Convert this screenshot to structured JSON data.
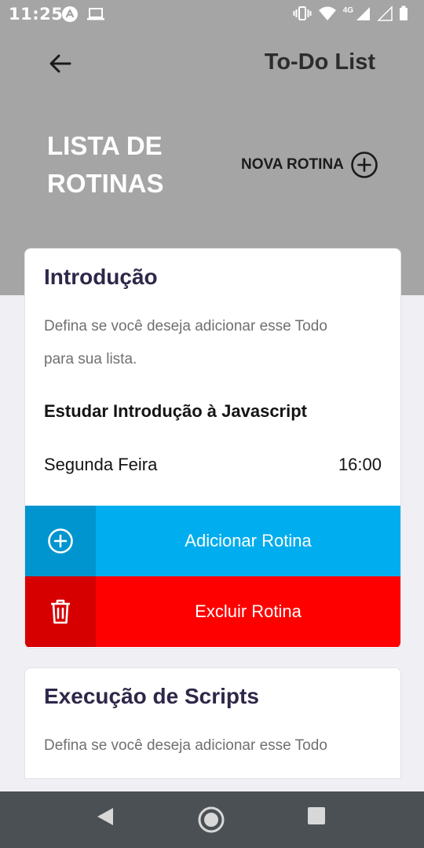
{
  "status_bar": {
    "time": "11:25",
    "network_label": "4G",
    "icons": [
      "app-notification-icon",
      "laptop-icon",
      "vibrate-icon",
      "wifi-icon",
      "signal-icon",
      "signal-empty-icon",
      "battery-icon"
    ]
  },
  "header": {
    "title": "To-Do List",
    "list_title_line1": "LISTA DE",
    "list_title_line2": "ROTINAS",
    "new_routine_label": "NOVA ROTINA"
  },
  "cards": [
    {
      "title": "Introdução",
      "description_line1": "Defina se você deseja adicionar esse Todo",
      "description_line2": "para sua lista.",
      "subject": "Estudar Introdução à Javascript",
      "day": "Segunda Feira",
      "time": "16:00",
      "add_label": "Adicionar Rotina",
      "delete_label": "Excluir Rotina"
    },
    {
      "title": "Execução de Scripts",
      "description_line1": "Defina se você deseja adicionar esse Todo"
    }
  ],
  "colors": {
    "header_bg": "#a5a5a5",
    "add_accent": "#00adee",
    "delete_accent": "#ff0000",
    "title_text": "#2f2749",
    "nav_bar": "#4b5054"
  }
}
